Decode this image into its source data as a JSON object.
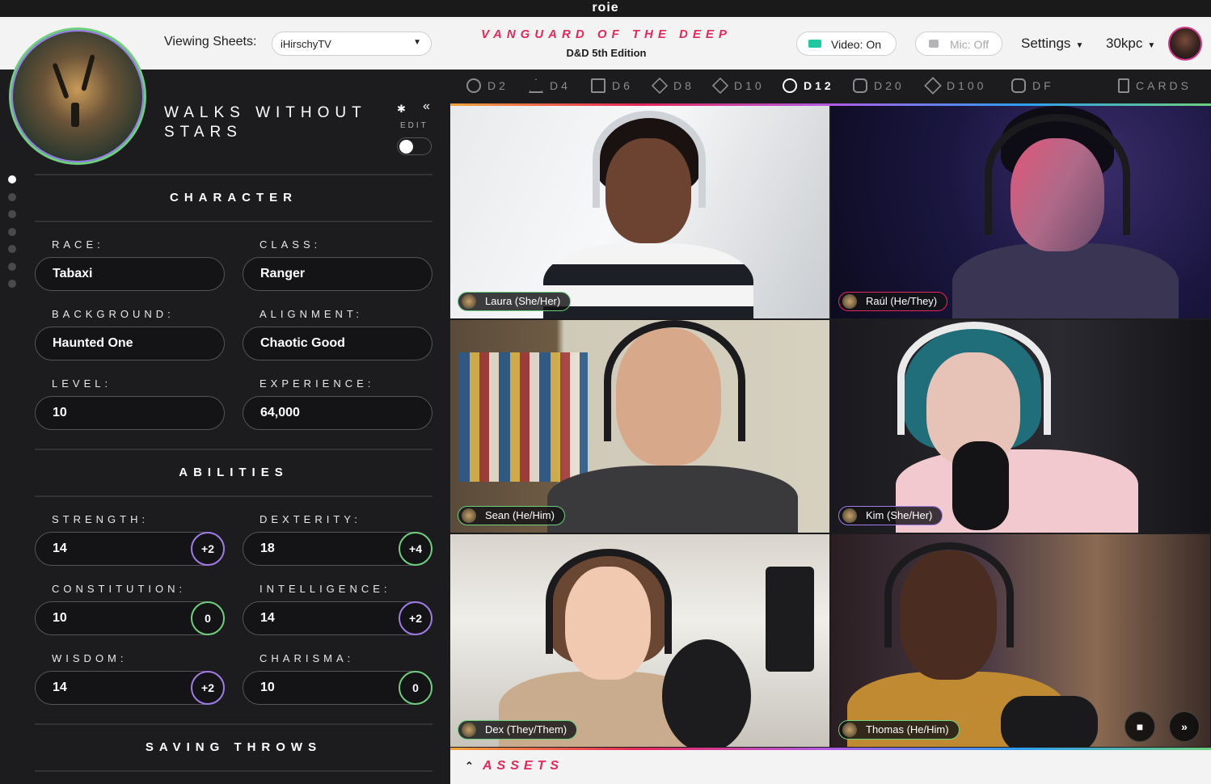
{
  "window": {
    "title": "roie"
  },
  "header": {
    "viewing_label": "Viewing Sheets:",
    "sheet_selected": "iHirschyTV",
    "campaign_title": "VANGUARD OF THE DEEP",
    "campaign_subtitle": "D&D 5th Edition",
    "video_label": "Video: On",
    "mic_label": "Mic: Off",
    "settings_label": "Settings",
    "units_label": "30kpc"
  },
  "character": {
    "name": "WALKS WITHOUT STARS",
    "edit_label": "EDIT",
    "edit_enabled": false,
    "nav_dots": 7,
    "active_dot": 0,
    "section_character": "CHARACTER",
    "fields": {
      "race": {
        "label": "RACE:",
        "value": "Tabaxi"
      },
      "class": {
        "label": "CLASS:",
        "value": "Ranger"
      },
      "background": {
        "label": "BACKGROUND:",
        "value": "Haunted One"
      },
      "alignment": {
        "label": "ALIGNMENT:",
        "value": "Chaotic Good"
      },
      "level": {
        "label": "LEVEL:",
        "value": "10"
      },
      "experience": {
        "label": "EXPERIENCE:",
        "value": "64,000"
      }
    },
    "section_abilities": "ABILITIES",
    "abilities": {
      "strength": {
        "label": "STRENGTH:",
        "value": "14",
        "mod": "+2"
      },
      "dexterity": {
        "label": "DEXTERITY:",
        "value": "18",
        "mod": "+4"
      },
      "constitution": {
        "label": "CONSTITUTION:",
        "value": "10",
        "mod": "0"
      },
      "intelligence": {
        "label": "INTELLIGENCE:",
        "value": "14",
        "mod": "+2"
      },
      "wisdom": {
        "label": "WISDOM:",
        "value": "14",
        "mod": "+2"
      },
      "charisma": {
        "label": "CHARISMA:",
        "value": "10",
        "mod": "0"
      }
    },
    "section_saving": "SAVING THROWS"
  },
  "dice": {
    "items": [
      "D2",
      "D4",
      "D6",
      "D8",
      "D10",
      "D12",
      "D20",
      "D100",
      "DF"
    ],
    "active": "D12",
    "cards_label": "CARDS"
  },
  "participants": [
    {
      "name": "Laura (She/Her)"
    },
    {
      "name": "Raúl (He/They)"
    },
    {
      "name": "Sean (He/Him)"
    },
    {
      "name": "Kim (She/Her)"
    },
    {
      "name": "Dex (They/Them)"
    },
    {
      "name": "Thomas (He/Him)"
    }
  ],
  "assets": {
    "label": "ASSETS"
  },
  "colors": {
    "accent_pink": "#e6275b",
    "accent_green": "#6ecf7e",
    "accent_purple": "#a07ce8",
    "panel_bg": "#1c1c1e",
    "header_bg": "#f3f3f4"
  },
  "icons": {
    "video": "video-camera-icon",
    "mic": "mic-muted-icon",
    "settings_chevron": "chevron-down-icon",
    "gear": "gear-icon",
    "collapse": "double-chevron-left-icon",
    "assets": "double-chevron-up-icon",
    "tile_chat": "chat-icon",
    "tile_next": "double-chevron-right-icon",
    "cards": "cards-icon"
  }
}
